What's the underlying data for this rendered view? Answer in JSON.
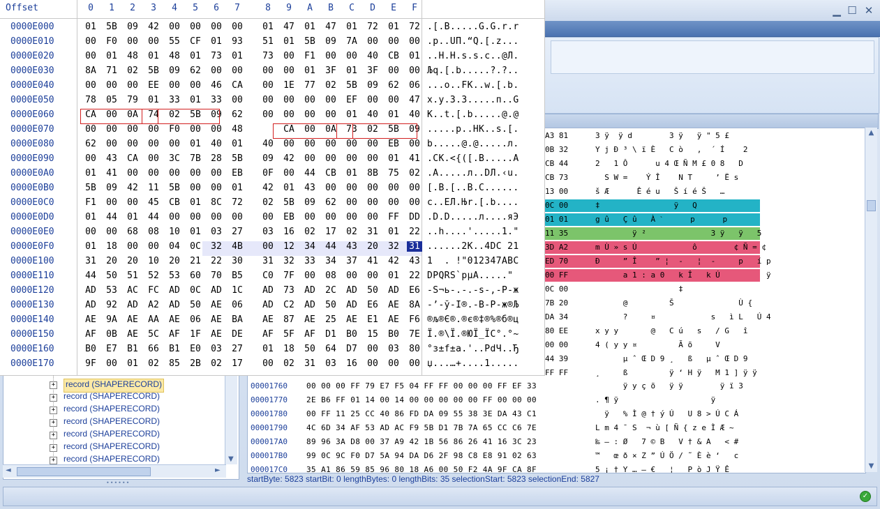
{
  "window": {
    "minimize_glyph": "▁",
    "maximize_glyph": "☐",
    "close_glyph": "✕"
  },
  "hex_popup": {
    "header": {
      "offset_label": "Offset",
      "columns": [
        "0",
        "1",
        "2",
        "3",
        "4",
        "5",
        "6",
        "7",
        "8",
        "9",
        "A",
        "B",
        "C",
        "D",
        "E",
        "F"
      ]
    },
    "rows": [
      {
        "offset": "0000E000",
        "bytes": [
          "01",
          "5B",
          "09",
          "42",
          "00",
          "00",
          "00",
          "00",
          "01",
          "47",
          "01",
          "47",
          "01",
          "72",
          "01",
          "72"
        ],
        "ascii": ".[.B.....G.G.r.r"
      },
      {
        "offset": "0000E010",
        "bytes": [
          "00",
          "F0",
          "00",
          "00",
          "55",
          "CF",
          "01",
          "93",
          "51",
          "01",
          "5B",
          "09",
          "7A",
          "00",
          "00",
          "00"
        ],
        "ascii": ".р..UП.“Q.[.z..."
      },
      {
        "offset": "0000E020",
        "bytes": [
          "00",
          "01",
          "48",
          "01",
          "48",
          "01",
          "73",
          "01",
          "73",
          "00",
          "F1",
          "00",
          "00",
          "40",
          "CB",
          "01"
        ],
        "ascii": "..H.H.s.s.с..@Л."
      },
      {
        "offset": "0000E030",
        "bytes": [
          "8A",
          "71",
          "02",
          "5B",
          "09",
          "62",
          "00",
          "00",
          "00",
          "00",
          "01",
          "3F",
          "01",
          "3F",
          "00",
          "00"
        ],
        "ascii": "Љq.[.b.....?.?.."
      },
      {
        "offset": "0000E040",
        "bytes": [
          "00",
          "00",
          "00",
          "EE",
          "00",
          "00",
          "46",
          "CA",
          "00",
          "1E",
          "77",
          "02",
          "5B",
          "09",
          "62",
          "06"
        ],
        "ascii": "...о..FК..w.[.b."
      },
      {
        "offset": "0000E050",
        "bytes": [
          "78",
          "05",
          "79",
          "01",
          "33",
          "01",
          "33",
          "00",
          "00",
          "00",
          "00",
          "00",
          "EF",
          "00",
          "00",
          "47"
        ],
        "ascii": "x.y.3.3.....п..G"
      },
      {
        "offset": "0000E060",
        "bytes": [
          "CA",
          "00",
          "0A",
          "74",
          "02",
          "5B",
          "09",
          "62",
          "00",
          "00",
          "00",
          "00",
          "01",
          "40",
          "01",
          "40"
        ],
        "ascii": "К..t.[.b.....@.@"
      },
      {
        "offset": "0000E070",
        "bytes": [
          "00",
          "00",
          "00",
          "00",
          "F0",
          "00",
          "00",
          "48",
          "CA",
          "00",
          "0A",
          "73",
          "02",
          "5B",
          "09"
        ],
        "ascii": ".....р..HК..s.[."
      },
      {
        "offset": "0000E080",
        "bytes": [
          "62",
          "00",
          "00",
          "00",
          "00",
          "01",
          "40",
          "01",
          "40",
          "00",
          "00",
          "00",
          "00",
          "00",
          "EB",
          "00"
        ],
        "ascii": "b.....@.@.....л."
      },
      {
        "offset": "0000E090",
        "bytes": [
          "00",
          "43",
          "CA",
          "00",
          "3C",
          "7B",
          "28",
          "5B",
          "09",
          "42",
          "00",
          "00",
          "00",
          "00",
          "01",
          "41"
        ],
        "ascii": ".CК.<{([.B.....A"
      },
      {
        "offset": "0000E0A0",
        "bytes": [
          "01",
          "41",
          "00",
          "00",
          "00",
          "00",
          "00",
          "EB",
          "0F",
          "00",
          "44",
          "CB",
          "01",
          "8B",
          "75",
          "02"
        ],
        "ascii": ".A.....л..DЛ.‹u."
      },
      {
        "offset": "0000E0B0",
        "bytes": [
          "5B",
          "09",
          "42",
          "11",
          "5B",
          "00",
          "00",
          "01",
          "42",
          "01",
          "43",
          "00",
          "00",
          "00",
          "00",
          "00"
        ],
        "ascii": "[.B.[..B.C......"
      },
      {
        "offset": "0000E0C0",
        "bytes": [
          "F1",
          "00",
          "00",
          "45",
          "CB",
          "01",
          "8C",
          "72",
          "02",
          "5B",
          "09",
          "62",
          "00",
          "00",
          "00",
          "00"
        ],
        "ascii": "с..EЛ.Њr.[.b...."
      },
      {
        "offset": "0000E0D0",
        "bytes": [
          "01",
          "44",
          "01",
          "44",
          "00",
          "00",
          "00",
          "00",
          "00",
          "EB",
          "00",
          "00",
          "00",
          "00",
          "FF",
          "DD"
        ],
        "ascii": ".D.D.....л....яЭ"
      },
      {
        "offset": "0000E0E0",
        "bytes": [
          "00",
          "00",
          "68",
          "08",
          "10",
          "01",
          "03",
          "27",
          "03",
          "16",
          "02",
          "17",
          "02",
          "31",
          "01",
          "22"
        ],
        "ascii": "..h....'.....1.\""
      },
      {
        "offset": "0000E0F0",
        "bytes": [
          "01",
          "18",
          "00",
          "00",
          "04",
          "0C",
          "32",
          "4B",
          "00",
          "12",
          "34",
          "44",
          "43",
          "20",
          "32",
          "31"
        ],
        "ascii": "......2K..4DC 21"
      },
      {
        "offset": "0000E100",
        "bytes": [
          "31",
          "20",
          "20",
          "10",
          "20",
          "21",
          "22",
          "30",
          "31",
          "32",
          "33",
          "34",
          "37",
          "41",
          "42",
          "43"
        ],
        "ascii": "1  . !\"012347ABC"
      },
      {
        "offset": "0000E110",
        "bytes": [
          "44",
          "50",
          "51",
          "52",
          "53",
          "60",
          "70",
          "B5",
          "C0",
          "7F",
          "00",
          "08",
          "00",
          "00",
          "01",
          "22"
        ],
        "ascii": "DPQRS`pµА.....\""
      },
      {
        "offset": "0000E120",
        "bytes": [
          "AD",
          "53",
          "AC",
          "FC",
          "AD",
          "0C",
          "AD",
          "1C",
          "AD",
          "73",
          "AD",
          "2C",
          "AD",
          "50",
          "AD",
          "E6"
        ],
        "ascii": "-S¬ь-.-.-s-,-P-ж"
      },
      {
        "offset": "0000E130",
        "bytes": [
          "AD",
          "92",
          "AD",
          "A2",
          "AD",
          "50",
          "AE",
          "06",
          "AD",
          "C2",
          "AD",
          "50",
          "AD",
          "E6",
          "AE",
          "8A"
        ],
        "ascii": "-’-ў-I®.-В-P-ж®Љ"
      },
      {
        "offset": "0000E140",
        "bytes": [
          "AE",
          "9A",
          "AE",
          "AA",
          "AE",
          "06",
          "AE",
          "BA",
          "AE",
          "87",
          "AE",
          "25",
          "AE",
          "E1",
          "AE",
          "F6"
        ],
        "ascii": "®љ®Є®.®є®‡®%®б®ц"
      },
      {
        "offset": "0000E150",
        "bytes": [
          "AF",
          "0B",
          "AE",
          "5C",
          "AF",
          "1F",
          "AE",
          "DE",
          "AF",
          "5F",
          "AF",
          "D1",
          "B0",
          "15",
          "B0",
          "7E"
        ],
        "ascii": "Ї.®\\Ї.®ЮЇ_ЇС°.°~"
      },
      {
        "offset": "0000E160",
        "bytes": [
          "B0",
          "E7",
          "B1",
          "66",
          "B1",
          "E0",
          "03",
          "27",
          "01",
          "18",
          "50",
          "64",
          "D7",
          "00",
          "03",
          "80"
        ],
        "ascii": "°з±f±а.'..PdЧ..Ђ"
      },
      {
        "offset": "0000E170",
        "bytes": [
          "9F",
          "00",
          "01",
          "02",
          "85",
          "2B",
          "02",
          "17",
          "00",
          "02",
          "31",
          "03",
          "16",
          "00",
          "00",
          "00"
        ],
        "ascii": "џ...…+....1....."
      }
    ]
  },
  "tree": {
    "items": [
      {
        "label": "record (SHAPERECORD)",
        "selected": true
      },
      {
        "label": "record (SHAPERECORD)",
        "selected": false
      },
      {
        "label": "record (SHAPERECORD)",
        "selected": false
      },
      {
        "label": "record (SHAPERECORD)",
        "selected": false
      },
      {
        "label": "record (SHAPERECORD)",
        "selected": false
      },
      {
        "label": "record (SHAPERECORD)",
        "selected": false
      },
      {
        "label": "record (SHAPERECORD)",
        "selected": false
      }
    ],
    "expand_glyph": "+"
  },
  "right_hex": {
    "upper_lines": [
      {
        "a": "A3 81",
        "b": "3 ÿ  ÿ d        3 ÿ   ÿ \" 5 £"
      },
      {
        "a": "0B 32",
        "b": "Y j Đ ³ \\ ï È   C ò   ‚  ´ Í    2"
      },
      {
        "a": "CB 44",
        "b": "2   1 Ô      u 4 Œ Ñ M £ 0 8   D"
      },
      {
        "a": "CB 73",
        "b": "  S W =    Ý Î    N T     ’ Ë s"
      },
      {
        "a": "13 00",
        "b": "š Æ      Ê é u   Š í é Š   …"
      },
      {
        "a": "0C 00",
        "b": "‡                ÿ   Q"
      },
      {
        "a": "01 01",
        "b": "g û   Ç û   À ˋ      p      p"
      },
      {
        "a": "11 35",
        "b": "        ÿ ²              3 ÿ   ÿ   5"
      },
      {
        "a": "3D A2",
        "b": "m Ù » s Ú            ô        ¢ Ñ = ¢"
      },
      {
        "a": "ED 70",
        "b": "Ð     ” Î    ” ¦  -   ¦  -     p   í p"
      },
      {
        "a": "00 FF",
        "b": "      a 1 : a 0   k Î   k Ú          ÿ"
      },
      {
        "a": "0C 00",
        "b": "                  ‡"
      },
      {
        "a": "7B 20",
        "b": "      @         Š              Ù {"
      },
      {
        "a": "DA 34",
        "b": "      ?     ¤            s   ì L   Ú 4"
      },
      {
        "a": "80 EE",
        "b": "x y y       @   C ú   s   / G   î"
      },
      {
        "a": "00 00",
        "b": "4 ( y y ¤         Ã õ     V"
      },
      {
        "a": "44 39",
        "b": "      µ ˆ Œ D 9 ¸   ß   µ ˆ Œ D 9"
      },
      {
        "a": "FF FF",
        "b": "¸     ß         ÿ ‘ H ÿ   M 1 ] ÿ ÿ"
      }
    ],
    "lines": [
      {
        "offset": "00001760",
        "hex": "00 00 00 FF 79 E7 F5 04 FF FF 00 00 00 FF EF 33",
        "ascii": "      ÿ y ç õ   ÿ ÿ        ÿ ï 3"
      },
      {
        "offset": "00001770",
        "hex": "2E B6 FF 01 14 00 14 00 00 00 00 00 FF 00 00 00",
        "ascii": ". ¶ ÿ                    ÿ"
      },
      {
        "offset": "00001780",
        "hex": "00 FF 11 25 CC 40 86 FD DA 09 55 38 3E DA 43 C1",
        "ascii": "  ÿ   % Ì @ † ý Ú   U 8 > Ú C Á"
      },
      {
        "offset": "00001790",
        "hex": "4C 6D 34 AF 53 AD AC F9 5B D1 7B 7A 65 CC C6 7E",
        "ascii": "L m 4 ¯ S ­ ¬ ù [ Ñ { z e Ì Æ ~"
      },
      {
        "offset": "000017A0",
        "hex": "89 96 3A D8 00 37 A9 42 1B 56 86 26 41 16 3C 23",
        "ascii": "‰ – : Ø   7 © B   V † & A   < #"
      },
      {
        "offset": "000017B0",
        "hex": "99 0C 9C F0 D7 5A 94 DA D6 2F 98 C8 E8 91 02 63",
        "ascii": "™   œ ð × Z ” Ú Ö / ˜ È è ‘   c"
      },
      {
        "offset": "000017C0",
        "hex": "35 A1 86 59 85 96 80 18 A6 00 50 F2 4A 9F CA 8F",
        "ascii": "5 ¡ † Y … – €   ¦   P ò J Ÿ Ê"
      }
    ],
    "colors": {
      "teal": "#23b3c6",
      "green": "#7cc46a",
      "orange": "#f0a030",
      "pink": "#e6587a"
    }
  },
  "status": {
    "text": "startByte: 5823 startBit: 0 lengthBytes: 0 lengthBits: 35 selectionStart: 5823 selectionEnd: 5827",
    "ok_glyph": "✓"
  },
  "scroll": {
    "up": "▲",
    "down": "▼",
    "left": "◄",
    "right": "►"
  },
  "grip_glyph": "••••••"
}
